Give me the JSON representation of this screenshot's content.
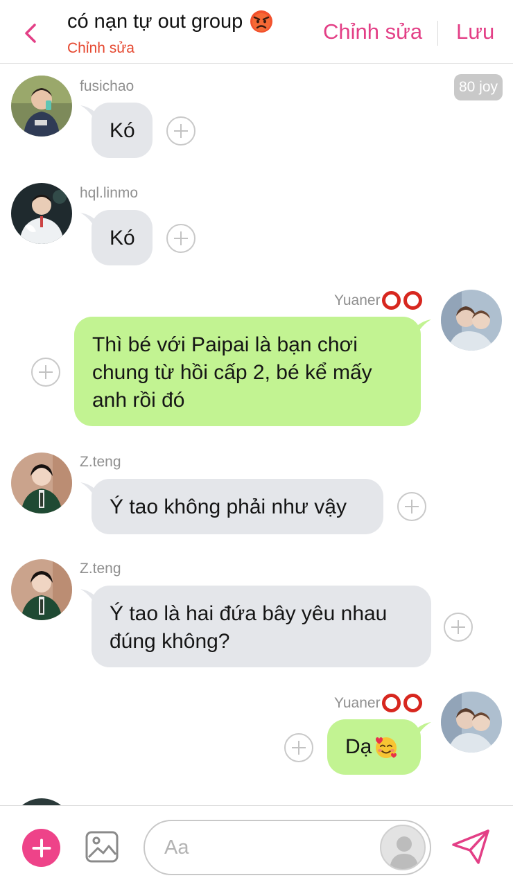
{
  "header": {
    "back_label": "‹",
    "title": "có nạn tự out group",
    "title_emoji": "angry-face",
    "subtitle": "Chỉnh sửa",
    "edit_label": "Chỉnh sửa",
    "save_label": "Lưu"
  },
  "badge": {
    "text": "80 joy"
  },
  "messages": [
    {
      "sender": "fusichao",
      "side": "in",
      "text": "Kó"
    },
    {
      "sender": "hql.linmo",
      "side": "in",
      "text": "Kó"
    },
    {
      "sender": "Yuaner",
      "side": "out",
      "text": "Thì bé với Paipai là bạn chơi chung từ hồi cấp 2, bé kể mấy anh rồi đó"
    },
    {
      "sender": "Z.teng",
      "side": "in",
      "text": "Ý tao không phải như vậy"
    },
    {
      "sender": "Z.teng",
      "side": "in",
      "text": "Ý tao là hai đứa bây yêu nhau đúng không?"
    },
    {
      "sender": "Yuaner",
      "side": "out",
      "text": "Dạ",
      "emoji": "smiling-face-with-hearts"
    }
  ],
  "composer": {
    "placeholder": "Aa"
  },
  "colors": {
    "accent": "#e33f86",
    "subtitle": "#e5472f",
    "incoming_bubble": "#e4e6ea",
    "outgoing_bubble": "#c2f392",
    "ring": "#d7271f"
  }
}
